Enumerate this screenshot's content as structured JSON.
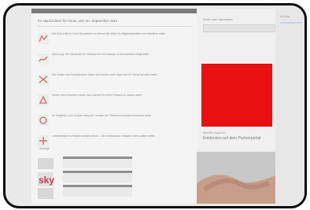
{
  "main": {
    "heading": "Ihr Nachrichten für heute, den 30. September 2011",
    "items": [
      {
        "text": "Mit Gott wollt ihr Gerd Schweitzer an Abend die Mittel für Mitgliedschaften bei Händlern",
        "link": "mehr"
      },
      {
        "text": "Samsung: Die Kaufkraft der Verbraucher für Handys in Deutschland steigt",
        "link": "mehr"
      },
      {
        "text": "Die Nutzer von Smartphones laden sich immer mehr Apps auf ihr Gerät herunter",
        "link": "mehr"
      },
      {
        "text": "Immer mehr Kunden nutzen das Internet für ihren Einkauf zu Hause",
        "link": "mehr"
      },
      {
        "text": "Im Vergleich zum Vorjahr stieg der Umsatz der Telekommunikationsbranche",
        "link": "mehr"
      },
      {
        "text": "Lebensmittel im Handel werden teurer – die Verbraucher müssen mehr zahlen",
        "link": "mehr"
      }
    ],
    "sky_label": "Anzeige",
    "sky_logo": "sky"
  },
  "right": {
    "search_label": "Suche nach Nachrichten",
    "promo_label": "Aktuelle Angebote",
    "promo_title": "Entdecken auf dem Partnerportal"
  },
  "rail": {
    "label": "Ihr Konto"
  },
  "colors": {
    "ad_red": "#e81111",
    "link": "#6d7f9a"
  }
}
